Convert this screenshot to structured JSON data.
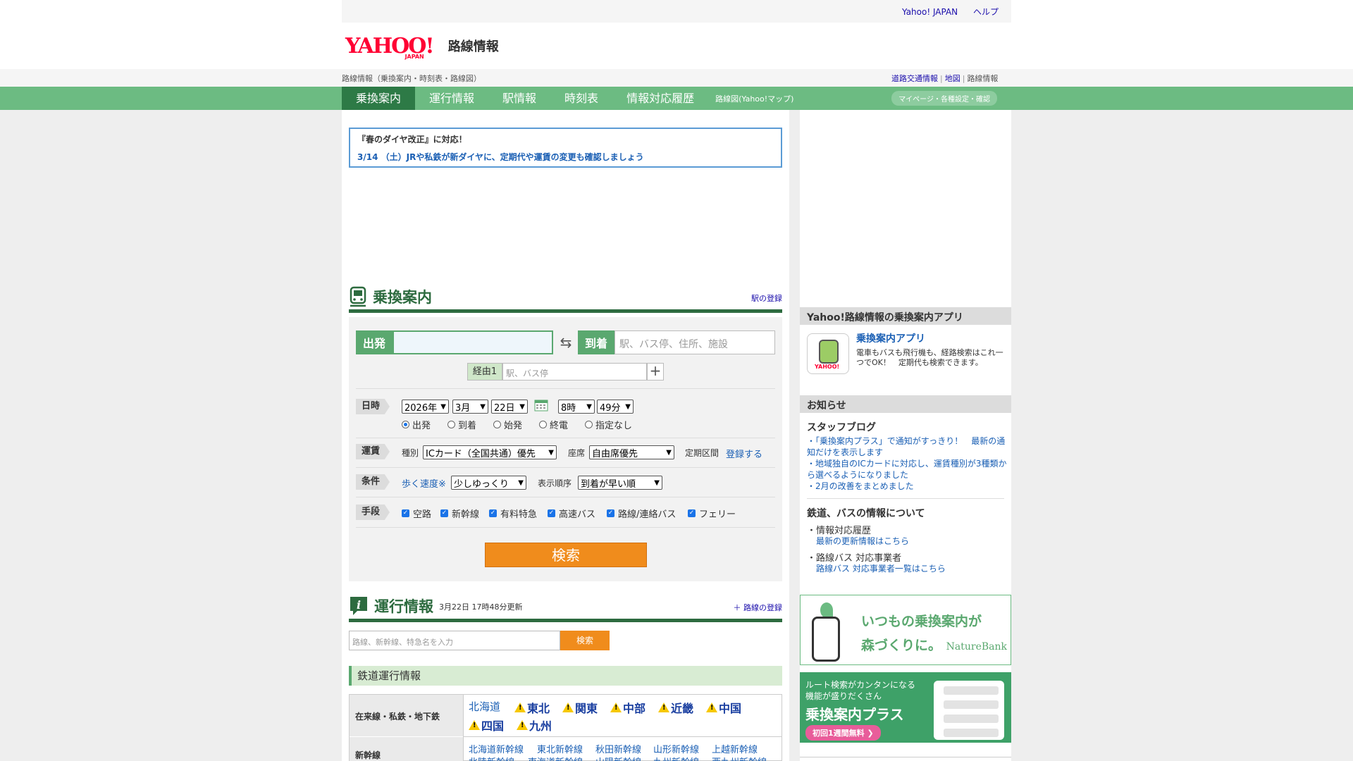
{
  "topbar": {
    "links": [
      "Yahoo! JAPAN",
      "ヘルプ"
    ]
  },
  "logo": {
    "brand": "YAHOO!",
    "brand_sub": "JAPAN",
    "service": "路線情報"
  },
  "breadcrumb": {
    "text": "路線情報（乗換案内・時刻表・路線図）",
    "links": [
      "道路交通情報",
      "地図"
    ],
    "current": "路線情報"
  },
  "nav": {
    "tabs": [
      "乗換案内",
      "運行情報",
      "駅情報",
      "時刻表",
      "情報対応履歴"
    ],
    "map_link": "路線図(Yahoo!マップ)",
    "mypage": "マイページ・各種設定・確認"
  },
  "notice": {
    "title": "『春のダイヤ改正』に対応！",
    "detail": "3/14 （土）JRや私鉄が新ダイヤに、定期代や運賃の変更も確認しましょう"
  },
  "route": {
    "title": "乗換案内",
    "station_register": "駅の登録",
    "from_label": "出発",
    "from_value": "",
    "to_label": "到着",
    "to_placeholder": "駅、バス停、住所、施設",
    "via_label": "経由1",
    "via_placeholder": "駅、バス停",
    "datetime_label": "日時",
    "year": "2026年",
    "month": "3月",
    "day": "22日",
    "hour": "8時",
    "minute": "49分",
    "time_types": [
      "出発",
      "到着",
      "始発",
      "終電",
      "指定なし"
    ],
    "selected_time_type": "出発",
    "fare_label": "運賃",
    "type_label": "種別",
    "fare_type": "ICカード（全国共通）優先",
    "seat_label": "座席",
    "seat_type": "自由席優先",
    "commuter_label": "定期区間",
    "commuter_link": "登録する",
    "condition_label": "条件",
    "walk_speed_label": "歩く速度※",
    "walk_speed": "少しゆっくり",
    "order_label": "表示順序",
    "order": "到着が早い順",
    "means_label": "手段",
    "means": [
      "空路",
      "新幹線",
      "有料特急",
      "高速バス",
      "路線/連絡バス",
      "フェリー"
    ],
    "search_button": "検索"
  },
  "operation": {
    "title": "運行情報",
    "updated": "3月22日 17時48分更新",
    "route_register": "＋ 路線の登録",
    "search_placeholder": "路線、新幹線、特急名を入力",
    "search_button": "検索",
    "rail_bar": "鉄道運行情報",
    "row1_label": "在来線・私鉄・地下鉄",
    "row2_label": "新幹線",
    "region_plain": "北海道",
    "regions_warn": [
      "東北",
      "関東",
      "中部",
      "近畿",
      "中国",
      "四国",
      "九州"
    ],
    "shinkansen": [
      "北海道新幹線",
      "東北新幹線",
      "秋田新幹線",
      "山形新幹線",
      "上越新幹線"
    ],
    "shinkansen2": [
      "北陸新幹線",
      "東海道新幹線",
      "山陽新幹線",
      "九州新幹線",
      "西九州新幹線"
    ]
  },
  "side": {
    "app_head": "Yahoo!路線情報の乗換案内アプリ",
    "app_title": "乗換案内アプリ",
    "app_desc": "電車もバスも飛行機も、経路検索はこれ一つでOK！　定期代も検索できます。",
    "app_icon_brand": "YAHOO!",
    "news_head": "お知らせ",
    "blog_title": "スタッフブログ",
    "blog_items": [
      "・「乗換案内プラス」で通知がすっきり！　最新の通知だけを表示します",
      "・地域独自のICカードに対応し、運賃種別が3種類から選べるようになりました",
      "・2月の改善をまとめました"
    ],
    "rail_info_title": "鉄道、バスの情報について",
    "info_history_title": "・情報対応履歴",
    "info_history_link": "最新の更新情報はこちら",
    "bus_title": "・路線バス 対応事業者",
    "bus_link": "路線バス 対応事業者一覧はこちら",
    "banner1_line1": "いつもの乗換案内が",
    "banner1_line2": "森づくりに。",
    "banner1_brand": "NatureBank",
    "banner2_sub": "ルート検索がカンタンになる\n機能が盛りだくさん",
    "banner2_main": "乗換案内プラス",
    "banner2_pill": "初回1週間無料 ❯"
  }
}
